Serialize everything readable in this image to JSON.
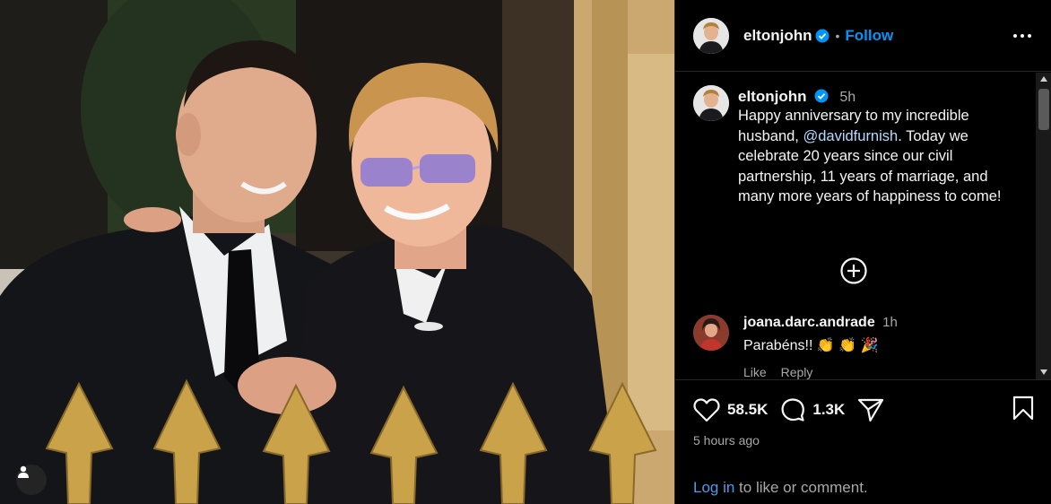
{
  "post": {
    "username": "eltonjohn",
    "follow_label": "Follow",
    "separator": "•"
  },
  "caption": {
    "username": "eltonjohn",
    "time": "5h",
    "text_before": "Happy anniversary to my incredible husband, ",
    "mention": "@davidfurnish",
    "text_after": ". Today we celebrate 20 years since our civil partnership, 11 years of marriage, and many more years of happiness to come!"
  },
  "comment": {
    "username": "joana.darc.andrade",
    "time": "1h",
    "text": "Parabéns!! 👏 👏 🎉",
    "like_label": "Like",
    "reply_label": "Reply"
  },
  "stats": {
    "likes": "58.5K",
    "comments": "1.3K"
  },
  "timestamp": "5 hours ago",
  "login": {
    "link_label": "Log in",
    "suffix": " to like or comment."
  },
  "icons": {
    "verified": "verified-badge-icon",
    "more": "more-options-icon",
    "load_more": "plus-circle-icon",
    "heart": "heart-icon",
    "comment": "comment-bubble-icon",
    "share": "paper-plane-icon",
    "save": "bookmark-icon",
    "user_tag": "user-tag-icon"
  },
  "colors": {
    "accent": "#0095f6",
    "verified": "#0095f6",
    "background": "#000000",
    "text": "#f5f5f5",
    "muted": "#a8a8a8"
  }
}
